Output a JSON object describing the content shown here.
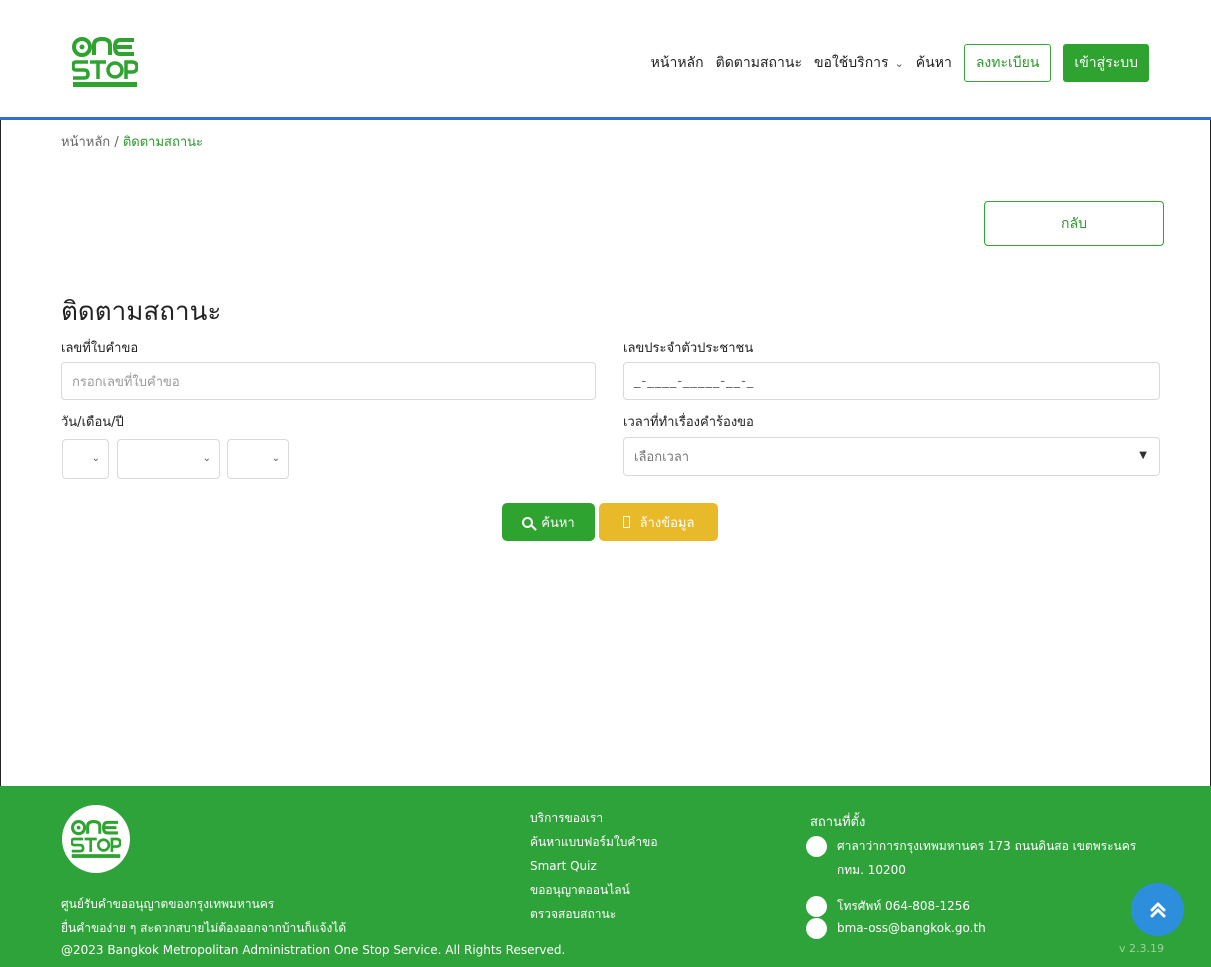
{
  "header": {
    "nav": {
      "home": "หน้าหลัก",
      "track_status": "ติดตามสถานะ",
      "services": "ขอใช้บริการ",
      "search": "ค้นหา",
      "register": "ลงทะเบียน",
      "login": "เข้าสู่ระบบ"
    }
  },
  "breadcrumb": {
    "home": "หน้าหลัก",
    "separator": "/",
    "current": "ติดตามสถานะ"
  },
  "back_button": "กลับ",
  "form": {
    "title": "ติดตามสถานะ",
    "request_no_label": "เลขที่ใบคำขอ",
    "request_no_placeholder": "กรอกเลขที่ใบคำขอ",
    "citizen_id_label": "เลขประจำตัวประชาชน",
    "citizen_id_mask": "_-____-_____-__-_",
    "date_label": "วัน/เดือน/ปี",
    "time_label": "เวลาที่ทำเรื่องคำร้องขอ",
    "time_placeholder": "เลือกเวลา",
    "search_button": "ค้นหา",
    "clear_button": "ล้างข้อมูล"
  },
  "footer": {
    "tagline1": "ศูนย์รับคำขออนุญาตของกรุงเทพมหานคร",
    "tagline2": "ยื่นคำของ่าย ๆ สะดวกสบายไม่ต้องออกจากบ้านก็แจ้งได้",
    "copyright": "@2023 Bangkok Metropolitan Administration One Stop Service. All Rights Reserved.",
    "services_links": [
      "บริการของเรา",
      "ค้นหาแบบฟอร์มใบคำขอ",
      "Smart Quiz",
      "ขออนุญาตออนไลน์",
      "ตรวจสอบสถานะ"
    ],
    "location_title": "สถานที่ตั้ง",
    "address_line1": "ศาลาว่าการกรุงเทพมหานคร 173 ถนนดินสอ เขตพระนคร",
    "address_line2": "กทม. 10200",
    "phone": "โทรศัพท์ 064-808-1256",
    "email": "bma-oss@bangkok.go.th",
    "version": "v 2.3.19"
  },
  "colors": {
    "primary_green": "#2ea32f",
    "warning_yellow": "#e8b929",
    "header_line_blue": "#2f6fd1",
    "scroll_top_blue": "#2d8fdb"
  }
}
